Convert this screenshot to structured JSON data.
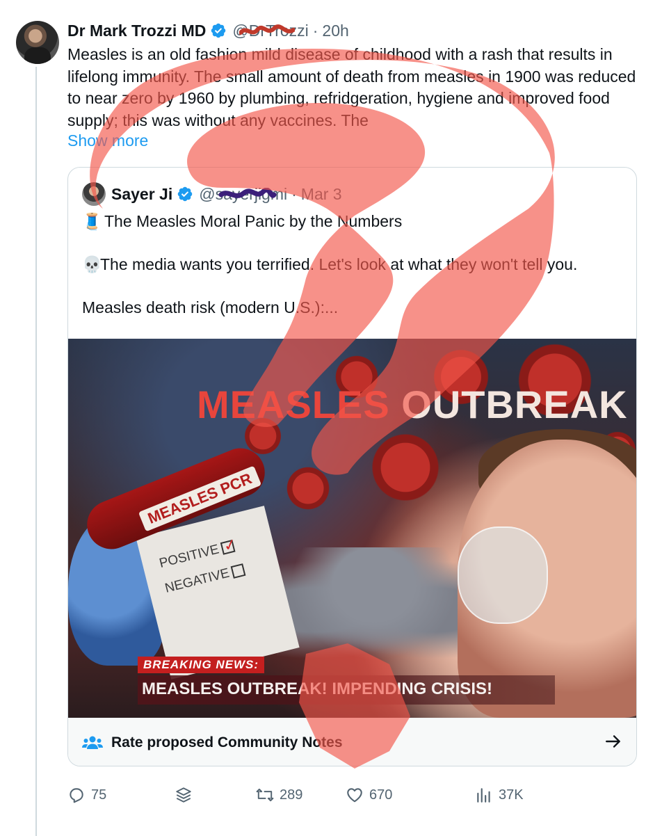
{
  "tweet": {
    "author_name": "Dr Mark Trozzi MD",
    "handle": "@DrTrozzi",
    "separator": "·",
    "time": "20h",
    "text": "Measles is an old fashion mild disease of childhood with a rash that results in lifelong immunity. The small amount of death from measles in 1900 was reduced to near zero by 1960 by plumbing, refridgeration, hygiene and improved food supply; this was without any vaccines. The",
    "show_more": "Show more"
  },
  "quote": {
    "author_name": "Sayer Ji",
    "handle": "@sayerjigmi",
    "separator": "·",
    "time": "Mar 3",
    "emoji_thread": "🧵",
    "line1": "The Measles Moral Panic by the Numbers",
    "emoji_skull": "💀",
    "line2": "The media wants you terrified. Let's look at what they won't tell you.",
    "line3": "Measles death risk (modern U.S.):..."
  },
  "image": {
    "headline_word1": "MEASLES",
    "headline_word2": "OUTBREAK",
    "tube_label": "MEASLES PCR",
    "positive": "POSITIVE",
    "negative": "NEGATIVE",
    "breaking": "BREAKING NEWS:",
    "ticker": "MEASLES OUTBREAK! IMPENDING CRISIS!"
  },
  "community_notes": {
    "label": "Rate proposed Community Notes",
    "icon": "people-icon"
  },
  "actions": {
    "replies": "75",
    "reposts": "289",
    "likes": "670",
    "views": "37K"
  },
  "colors": {
    "accent": "#1d9bf0",
    "overlay_question_mark": "#f2564a",
    "secondary_text": "#536471"
  }
}
